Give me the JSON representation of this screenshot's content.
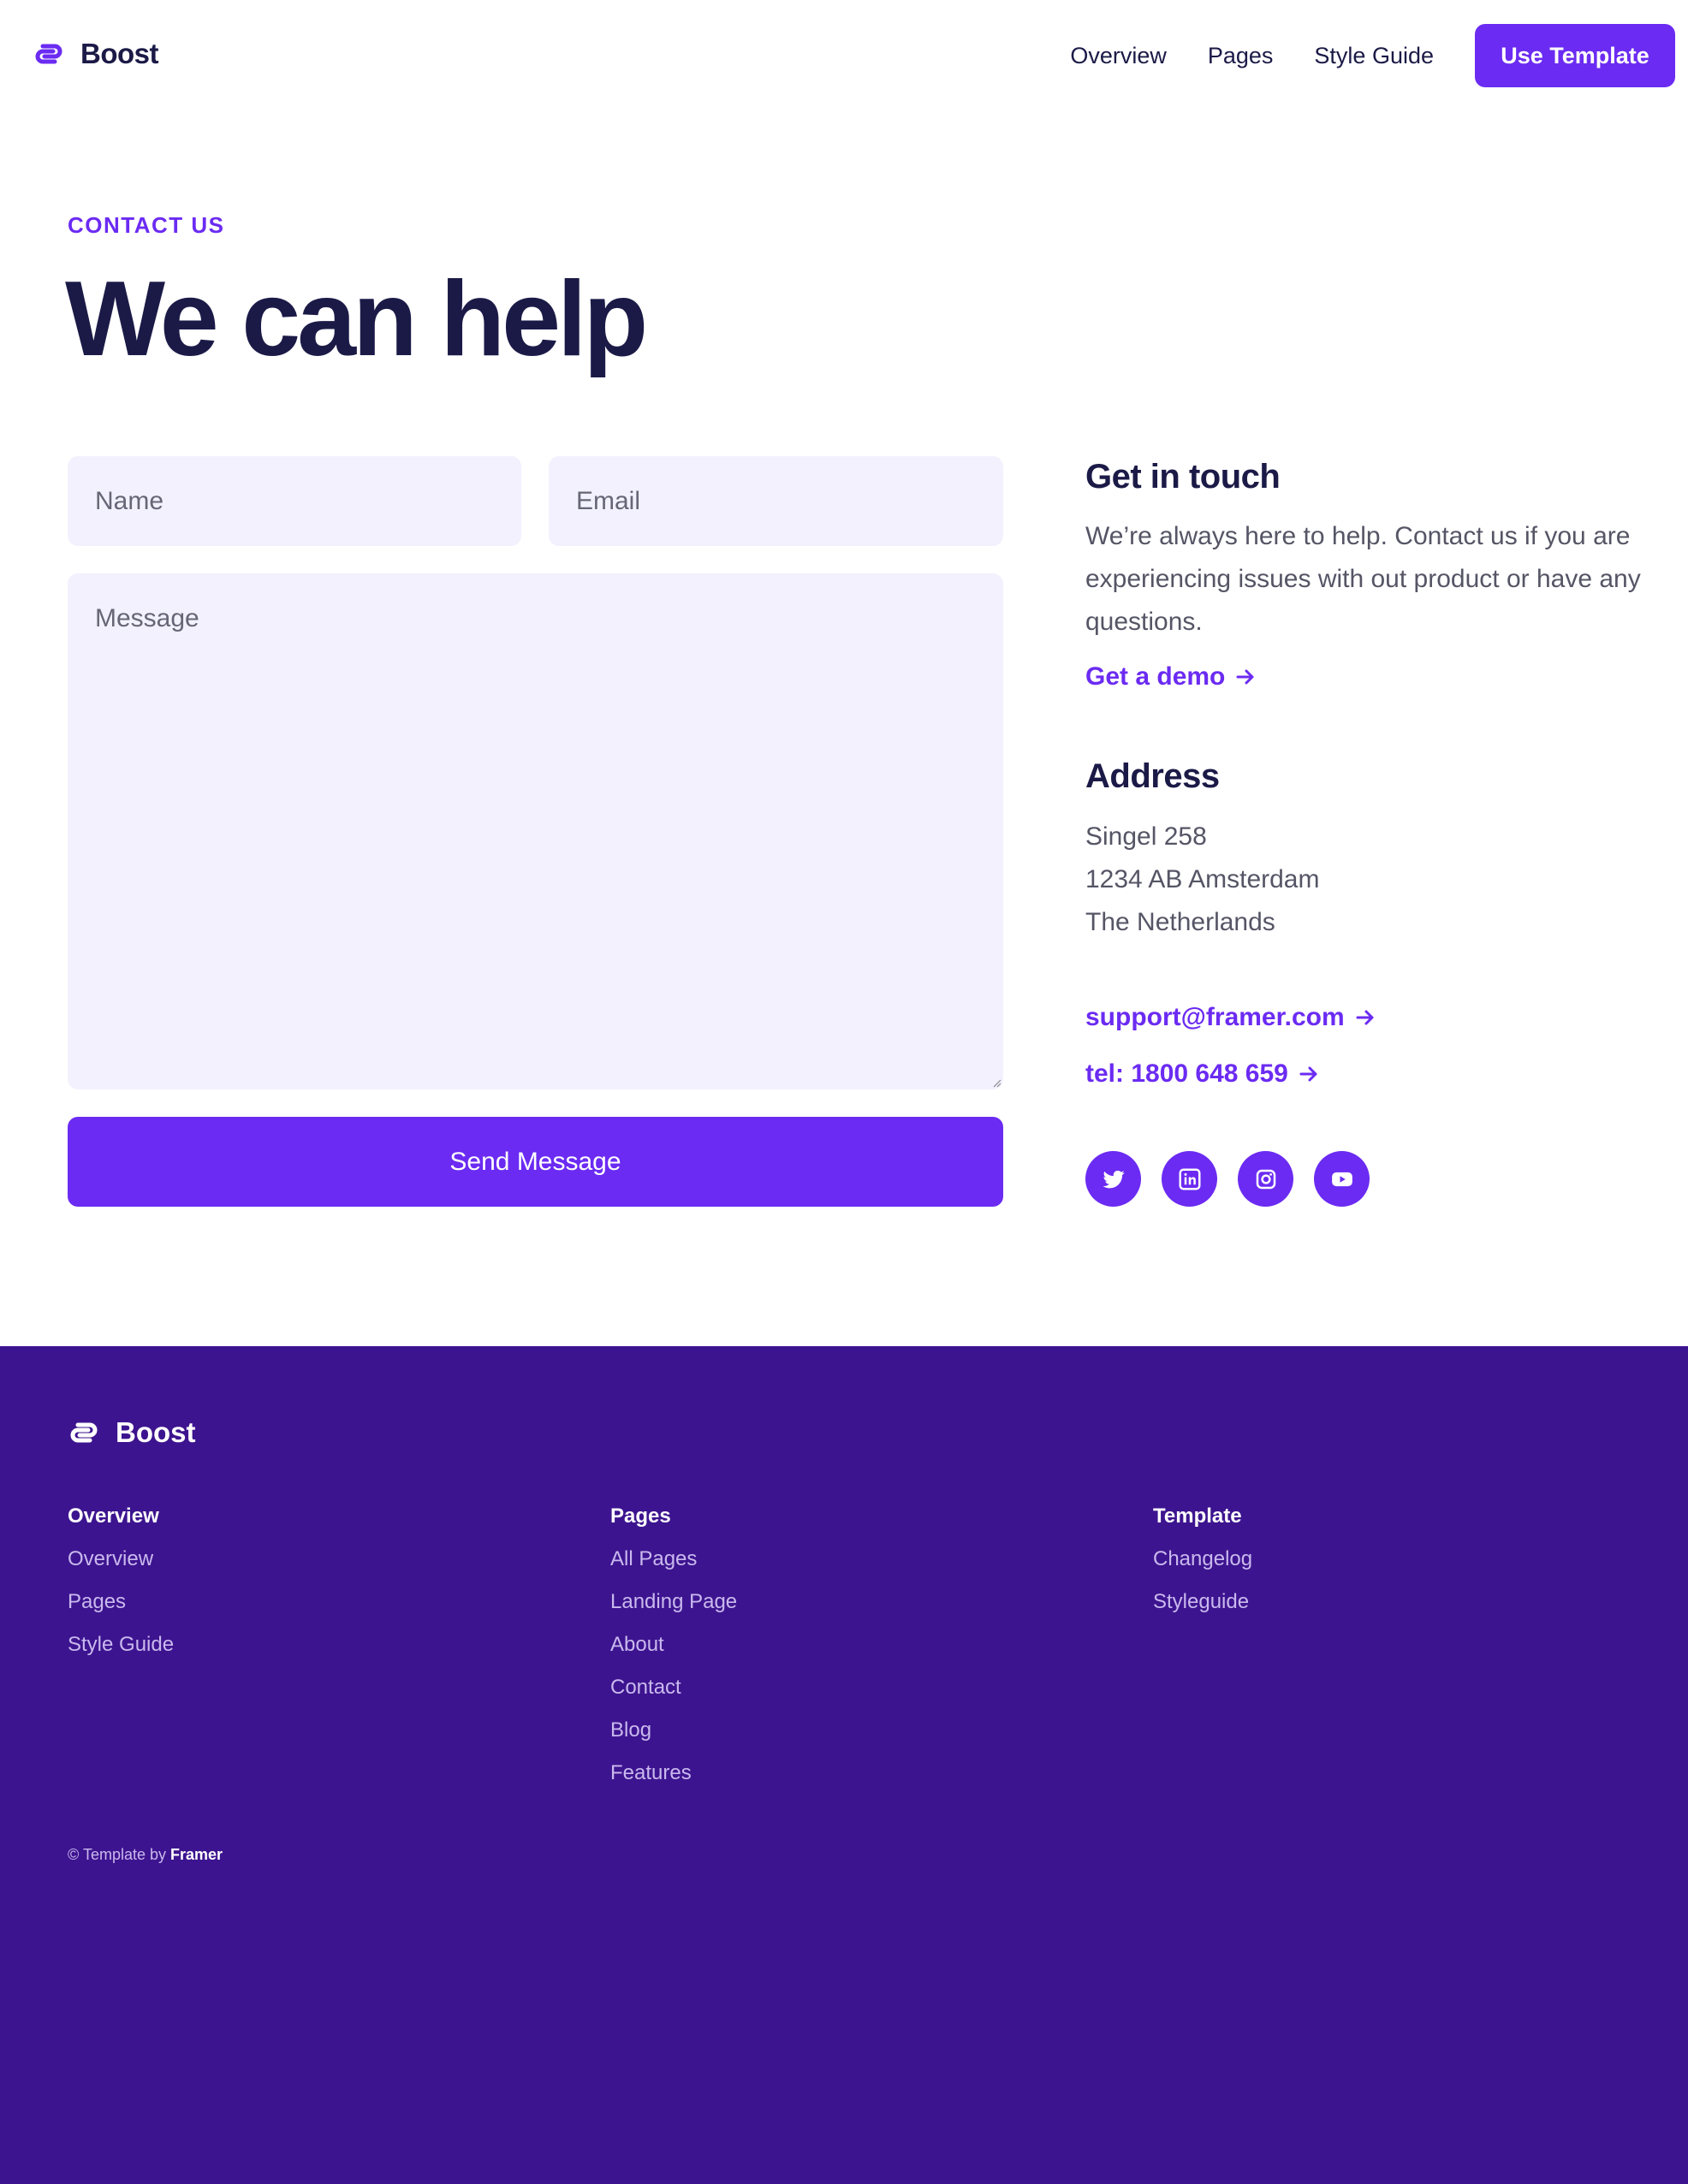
{
  "header": {
    "brand": "Boost",
    "nav": [
      "Overview",
      "Pages",
      "Style Guide"
    ],
    "cta": "Use Template"
  },
  "hero": {
    "eyebrow": "CONTACT US",
    "title": "We can help"
  },
  "form": {
    "name_placeholder": "Name",
    "email_placeholder": "Email",
    "message_placeholder": "Message",
    "submit_label": "Send Message"
  },
  "contact": {
    "title": "Get in touch",
    "body": "We’re always here to help. Contact us if you are experiencing issues with out product or have any questions.",
    "demo_link": "Get a demo",
    "address_title": "Address",
    "address_lines": [
      "Singel 258",
      "1234 AB Amsterdam",
      "The Netherlands"
    ],
    "email_link": "support@framer.com",
    "phone_link": "tel: 1800 648 659",
    "socials": [
      "twitter-icon",
      "linkedin-icon",
      "instagram-icon",
      "youtube-icon"
    ]
  },
  "footer": {
    "brand": "Boost",
    "columns": [
      {
        "title": "Overview",
        "items": [
          "Overview",
          "Pages",
          "Style Guide"
        ]
      },
      {
        "title": "Pages",
        "items": [
          "All Pages",
          "Landing Page",
          "About",
          "Contact",
          "Blog",
          "Features"
        ]
      },
      {
        "title": "Template",
        "items": [
          "Changelog",
          "Styleguide"
        ]
      }
    ],
    "copyright_prefix": "© Template by",
    "copyright_brand": "Framer"
  },
  "colors": {
    "accent": "#6b2bf2",
    "navy": "#1b1a47",
    "footer_bg": "#3d148f",
    "field_bg": "#f3f1fe"
  }
}
